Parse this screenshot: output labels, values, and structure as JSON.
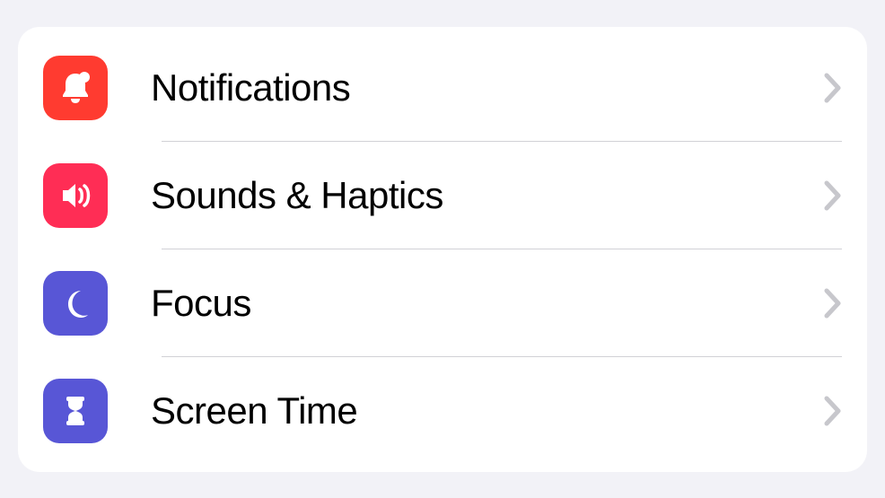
{
  "settings": {
    "items": [
      {
        "id": "notifications",
        "label": "Notifications",
        "icon": "bell-icon",
        "icon_color": "#ff3b30"
      },
      {
        "id": "sounds",
        "label": "Sounds & Haptics",
        "icon": "speaker-icon",
        "icon_color": "#ff2d55"
      },
      {
        "id": "focus",
        "label": "Focus",
        "icon": "moon-icon",
        "icon_color": "#5856d6"
      },
      {
        "id": "screentime",
        "label": "Screen Time",
        "icon": "hourglass-icon",
        "icon_color": "#5856d6"
      }
    ]
  }
}
